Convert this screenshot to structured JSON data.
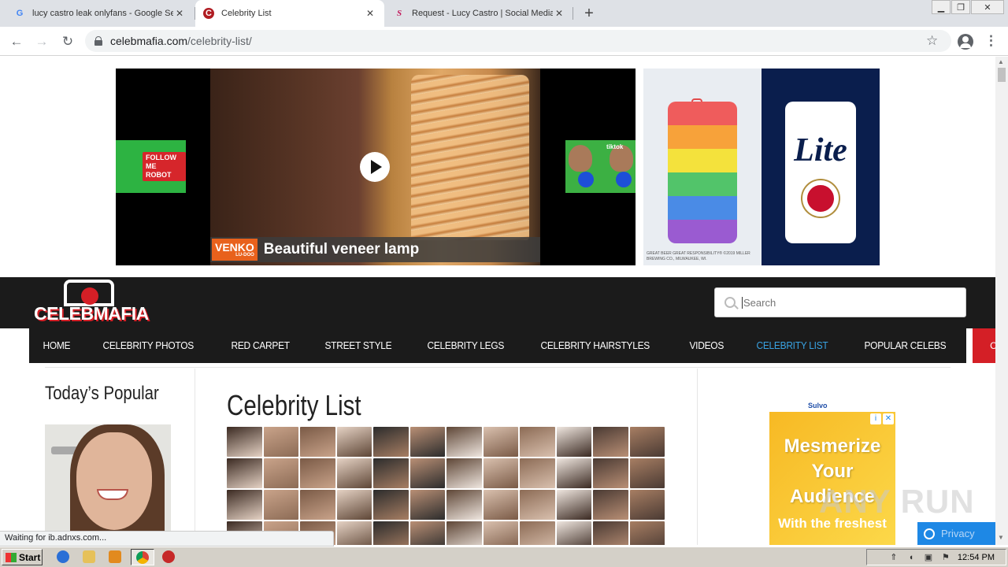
{
  "browser": {
    "tabs": [
      {
        "title": "lucy castro leak onlyfans - Google Se",
        "favicon": "google-icon",
        "active": false
      },
      {
        "title": "Celebrity List",
        "favicon": "celebmafia-icon",
        "active": true
      },
      {
        "title": "Request - Lucy Castro | Social Media",
        "favicon": "request-icon",
        "active": false
      }
    ],
    "close_glyph": "✕",
    "new_tab_glyph": "+",
    "url_host": "celebmafia.com",
    "url_path": "/celebrity-list/"
  },
  "ads": {
    "video_brand": "VENKO",
    "video_brand_sub": "LU-DOO",
    "video_caption": "Beautiful veneer lamp",
    "thumb_left_text": "FOLLOW ME ROBOT",
    "thumb_right_text": "tiktok",
    "beer_logo": "Lite",
    "beer_fineprint": "GREAT BEER GREAT RESPONSIBILITY® ©2019 MILLER BREWING CO., MILWAUKEE, WI.",
    "side_sponsor": "Sulvo",
    "side_title": "Mesmerize Your Audience",
    "side_sub": "With the freshest"
  },
  "site": {
    "logo": "CELEBMAFIA",
    "search_placeholder": "Search",
    "nav": [
      {
        "label": "HOME",
        "state": "normal"
      },
      {
        "label": "CELEBRITY PHOTOS",
        "state": "normal"
      },
      {
        "label": "RED CARPET",
        "state": "normal"
      },
      {
        "label": "STREET STYLE",
        "state": "normal"
      },
      {
        "label": "CELEBRITY LEGS",
        "state": "normal"
      },
      {
        "label": "CELEBRITY HAIRSTYLES",
        "state": "normal"
      },
      {
        "label": "VIDEOS",
        "state": "normal"
      },
      {
        "label": "CELEBRITY LIST",
        "state": "current"
      },
      {
        "label": "POPULAR CELEBS",
        "state": "normal"
      },
      {
        "label": "CELEBRITY STYLE",
        "state": "highlight"
      }
    ],
    "sidebar_heading": "Today’s Popular",
    "page_title": "Celebrity List",
    "privacy_label": "Privacy",
    "watermark": "ANY RUN"
  },
  "status_text": "Waiting for ib.adnxs.com...",
  "taskbar": {
    "start_label": "Start",
    "clock": "12:54 PM"
  },
  "colors": {
    "nav_current": "#39a3e3",
    "nav_highlight": "#d41f26",
    "header_bg": "#1b1b1b"
  }
}
